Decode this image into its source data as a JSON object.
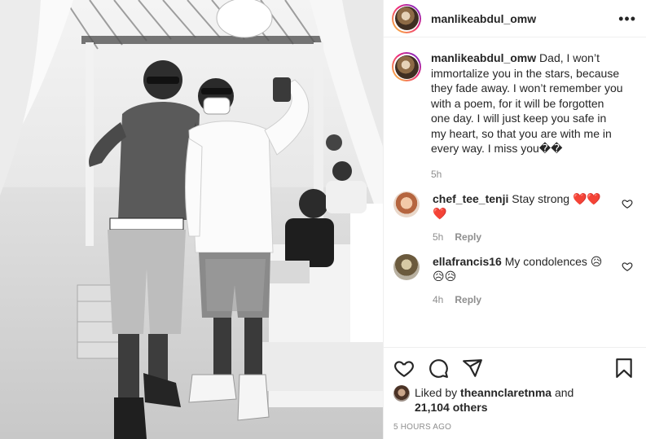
{
  "post": {
    "username": "manlikeabdul_omw",
    "more_icon": "more-options-icon"
  },
  "caption": {
    "username": "manlikeabdul_omw",
    "text": "Dad, I won’t immortalize you in the stars, because they fade away. I won’t remember you with a poem, for it will be forgotten one day. I will just keep you safe in my heart, so that you are with me in every way. I miss you��",
    "time": "5h"
  },
  "comments": [
    {
      "username": "chef_tee_tenji",
      "text": "Stay strong ❤️❤️❤️",
      "time": "5h",
      "reply_label": "Reply"
    },
    {
      "username": "ellafrancis16",
      "text": "My condolences 😥😥😥",
      "time": "4h",
      "reply_label": "Reply"
    }
  ],
  "likes": {
    "prefix": "Liked by",
    "liked_by": "theannclaretnma",
    "connector": "and",
    "others": "21,104 others"
  },
  "timestamp": "5 HOURS AGO",
  "colors": {
    "text": "#262626",
    "muted": "#8e8e8e",
    "border": "#efefef",
    "heart": "#ed4956"
  }
}
